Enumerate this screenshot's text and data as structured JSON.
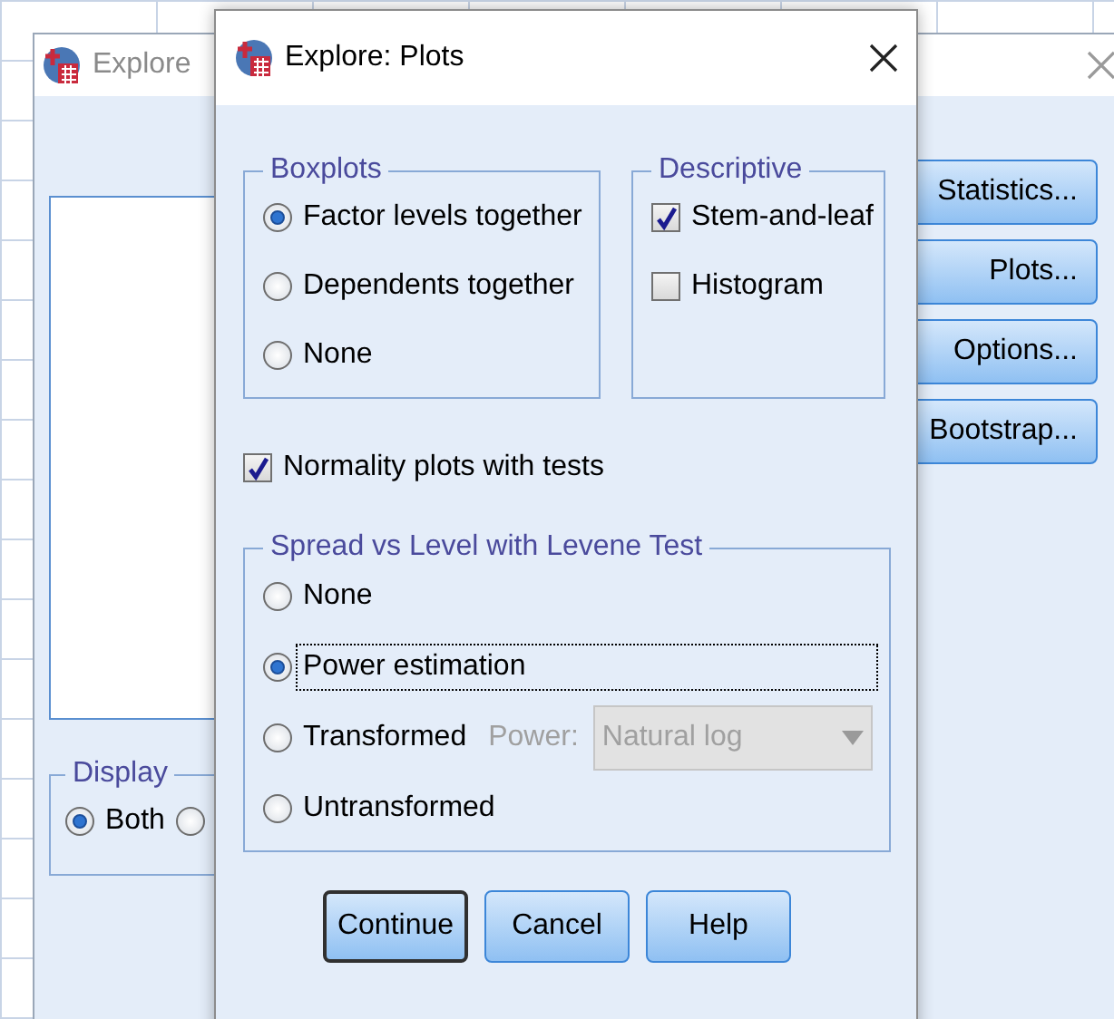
{
  "background_window": {
    "title": "Explore",
    "display": {
      "legend": "Display",
      "options": [
        {
          "label": "Both",
          "selected": true
        },
        {
          "selected": false
        }
      ]
    },
    "buttons": [
      "Statistics...",
      "Plots...",
      "Options...",
      "Bootstrap..."
    ]
  },
  "dialog": {
    "title": "Explore: Plots",
    "boxplots": {
      "legend": "Boxplots",
      "options": [
        {
          "label": "Factor levels together",
          "selected": true
        },
        {
          "label": "Dependents together",
          "selected": false
        },
        {
          "label": "None",
          "selected": false
        }
      ]
    },
    "descriptive": {
      "legend": "Descriptive",
      "items": [
        {
          "label": "Stem-and-leaf",
          "checked": true
        },
        {
          "label": "Histogram",
          "checked": false
        }
      ]
    },
    "normality": {
      "label": "Normality plots with tests",
      "checked": true
    },
    "spread": {
      "legend": "Spread vs Level with Levene Test",
      "options": [
        {
          "label": "None",
          "selected": false,
          "focused": false,
          "kind": "plain"
        },
        {
          "label": "Power estimation",
          "selected": true,
          "focused": true,
          "kind": "plain"
        },
        {
          "label": "Transformed",
          "selected": false,
          "focused": false,
          "kind": "power"
        },
        {
          "label": "Untransformed",
          "selected": false,
          "focused": false,
          "kind": "plain"
        }
      ],
      "power": {
        "label": "Power:",
        "value": "Natural log",
        "disabled": true
      }
    },
    "buttons": [
      {
        "label": "Continue",
        "default": true
      },
      {
        "label": "Cancel",
        "default": false
      },
      {
        "label": "Help",
        "default": false
      }
    ]
  }
}
